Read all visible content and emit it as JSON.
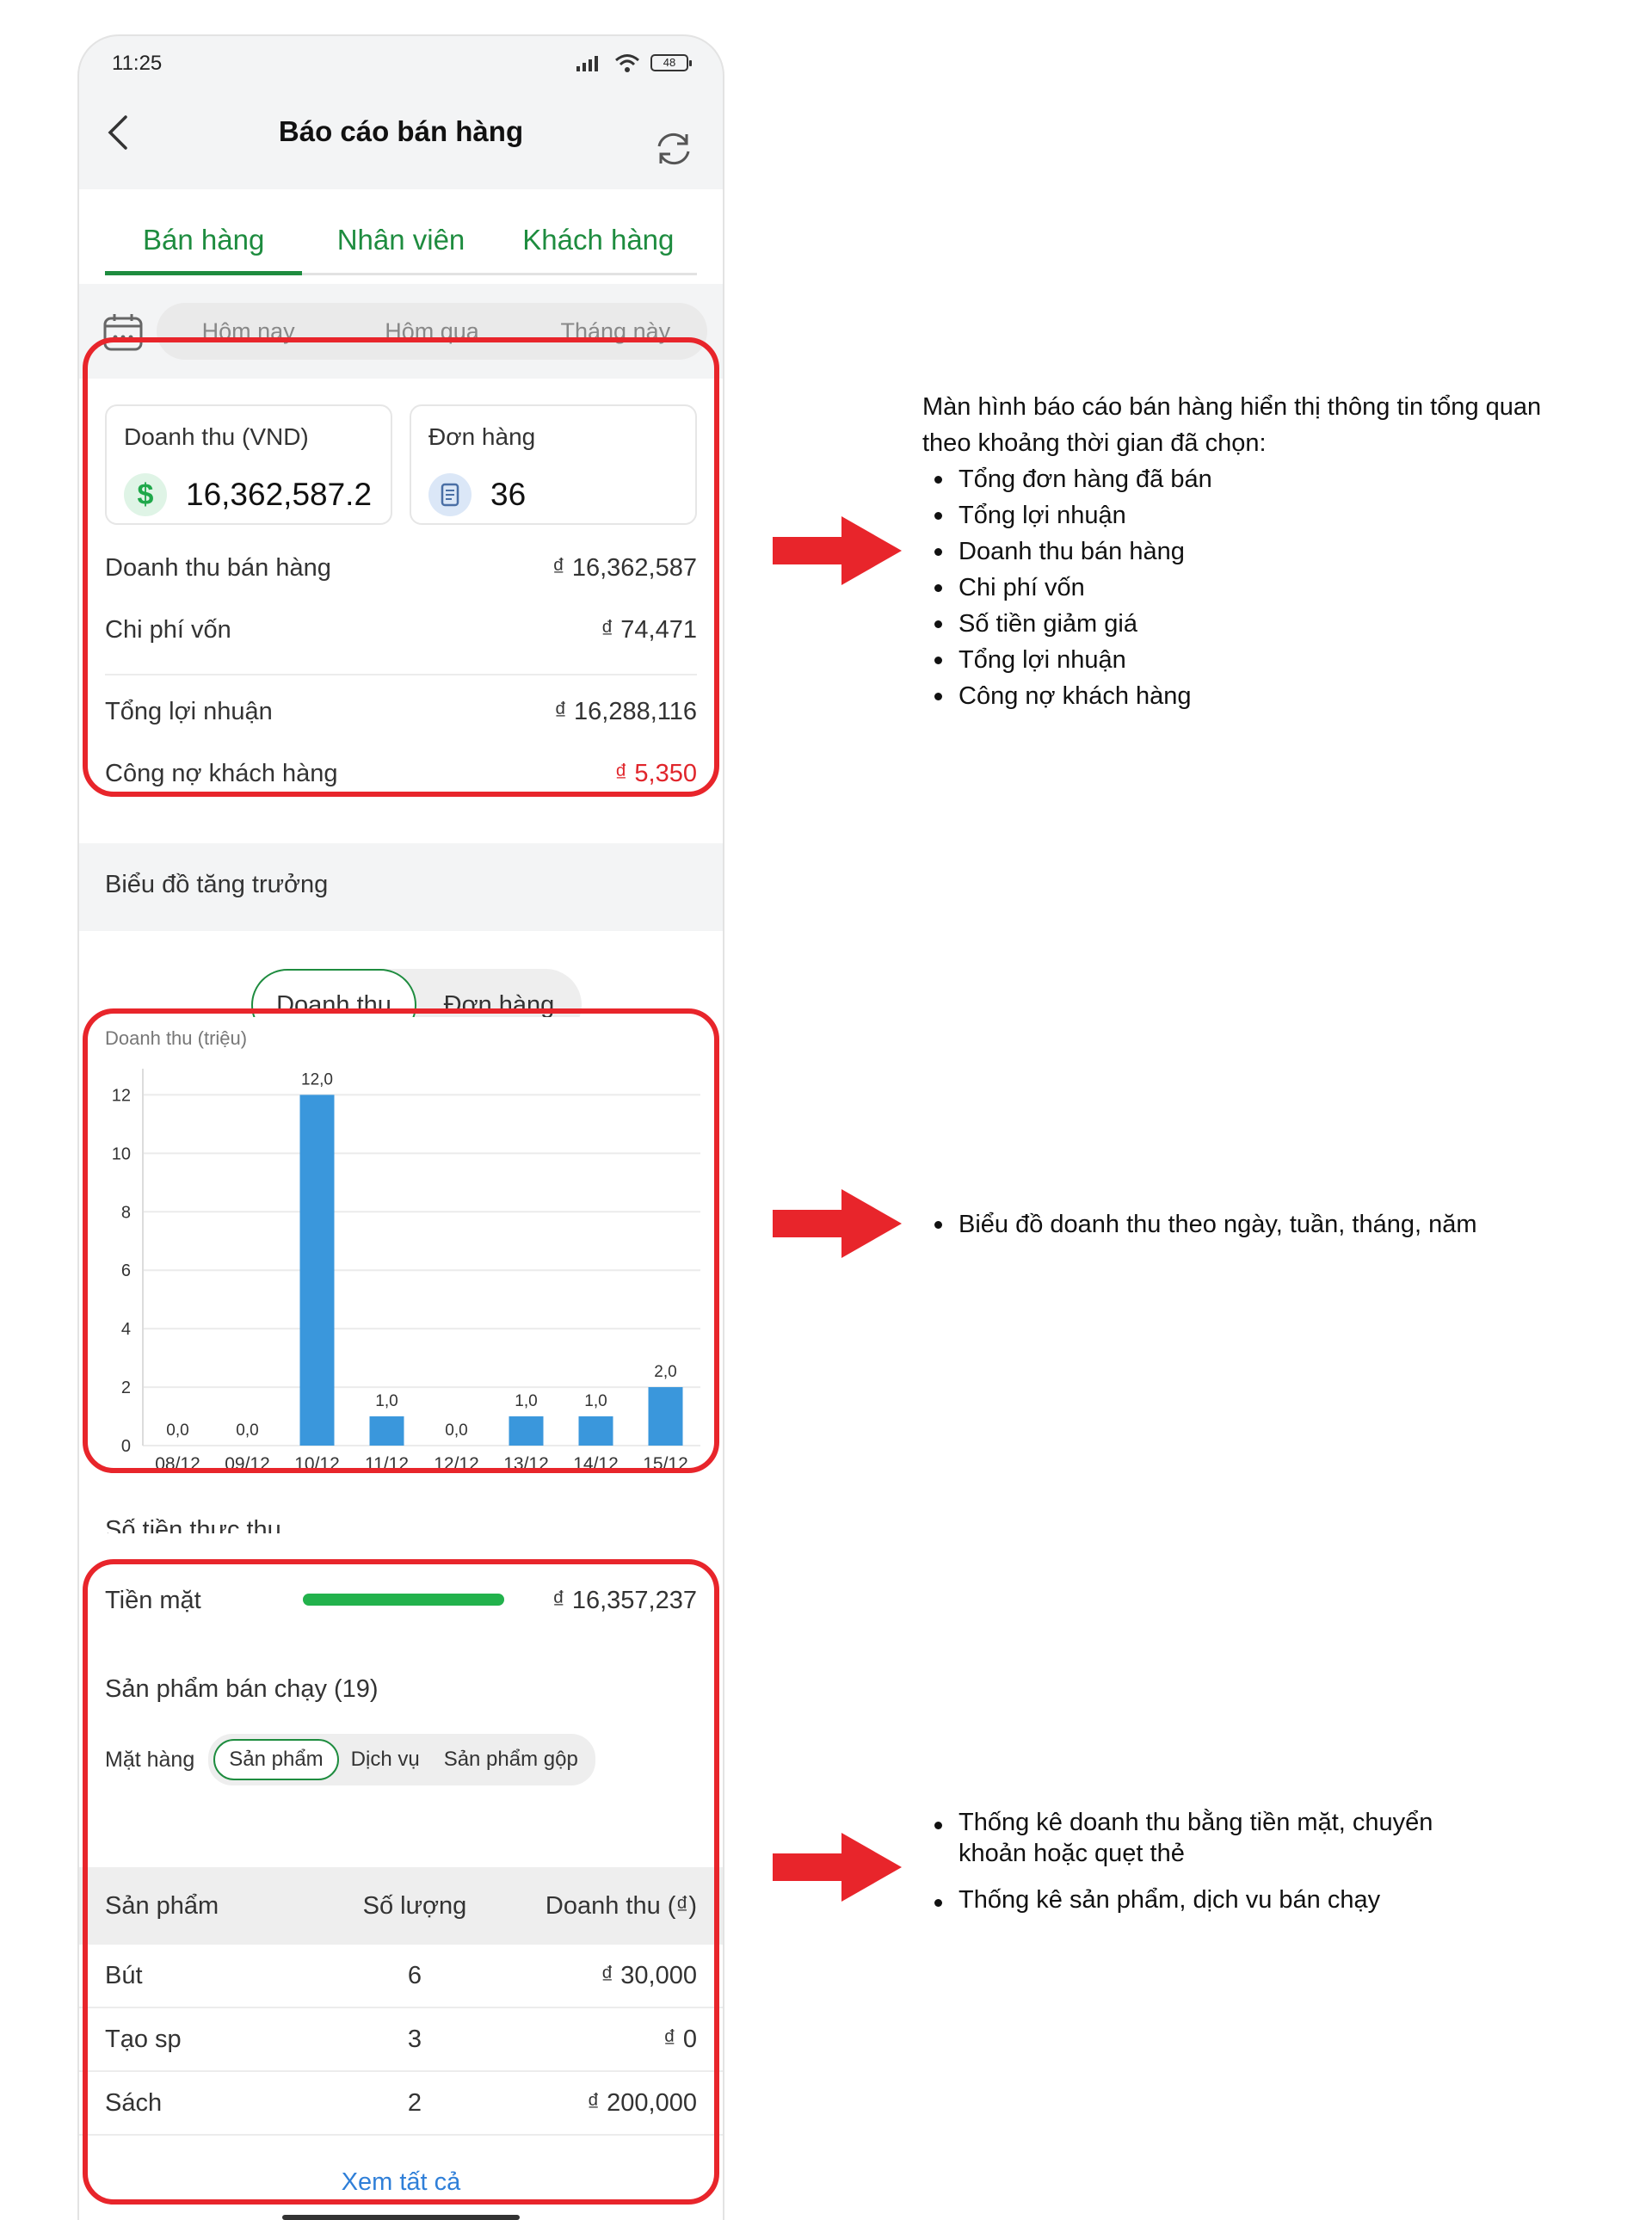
{
  "status_bar": {
    "time": "11:25",
    "battery": "48"
  },
  "header": {
    "title": "Báo cáo bán hàng"
  },
  "tabs": [
    {
      "label": "Bán hàng",
      "active": true
    },
    {
      "label": "Nhân viên",
      "active": false
    },
    {
      "label": "Khách hàng",
      "active": false
    }
  ],
  "date_filters": [
    "Hôm nay",
    "Hôm qua",
    "Tháng này"
  ],
  "summary": {
    "revenue_card": {
      "label": "Doanh thu (VND)",
      "value": "16,362,587.2"
    },
    "orders_card": {
      "label": "Đơn hàng",
      "value": "36"
    },
    "rows": [
      {
        "label": "Doanh thu bán hàng",
        "value": "₫ 16,362,587"
      },
      {
        "label": "Chi phí vốn",
        "value": "₫ 74,471"
      },
      {
        "label": "Tổng lợi nhuận",
        "value": "₫ 16,288,116"
      },
      {
        "label": "Công nợ khách hàng",
        "value": "₫ 5,350"
      }
    ]
  },
  "growth": {
    "title": "Biểu đồ tăng trưởng",
    "toggle": [
      {
        "label": "Doanh thu",
        "active": true
      },
      {
        "label": "Đơn hàng",
        "active": false
      }
    ]
  },
  "chart_data": {
    "type": "bar",
    "ylabel": "Doanh thu (triệu)",
    "categories": [
      "08/12",
      "09/12",
      "10/12",
      "11/12",
      "12/12",
      "13/12",
      "14/12",
      "15/12"
    ],
    "values": [
      0,
      0,
      12,
      1,
      0,
      1,
      1,
      2
    ],
    "data_labels": [
      "0,0",
      "0,0",
      "12,0",
      "1,0",
      "0,0",
      "1,0",
      "1,0",
      "2,0"
    ],
    "yticks": [
      0,
      2,
      4,
      6,
      8,
      10,
      12
    ],
    "ylim": [
      0,
      12.6
    ],
    "grid": true,
    "color": "#3a97dc"
  },
  "payment": {
    "title": "Số tiền thực thu",
    "method": "Tiền mặt",
    "amount": "₫ 16,357,237",
    "share": 1.0
  },
  "bestsellers": {
    "title": "Sản phẩm bán chạy (19)",
    "filter_label": "Mặt hàng",
    "filters": [
      {
        "label": "Sản phẩm",
        "active": true
      },
      {
        "label": "Dịch vụ",
        "active": false
      },
      {
        "label": "Sản phẩm gộp",
        "active": false
      }
    ],
    "columns": [
      "Sản phẩm",
      "Số lượng",
      "Doanh thu (₫)"
    ],
    "rows": [
      {
        "name": "Bút",
        "qty": "6",
        "revenue": "₫ 30,000"
      },
      {
        "name": "Tạo sp",
        "qty": "3",
        "revenue": "₫ 0"
      },
      {
        "name": "Sách",
        "qty": "2",
        "revenue": "₫ 200,000"
      }
    ],
    "view_all": "Xem tất cả"
  },
  "annotations": {
    "note1": {
      "intro": "Màn hình báo cáo bán hàng hiển thị thông tin tổng quan theo khoảng thời gian đã chọn:",
      "items": [
        "Tổng đơn hàng đã bán",
        "Tổng lợi nhuận",
        "Doanh thu bán hàng",
        "Chi phí vốn",
        "Số tiền giảm giá",
        "Tổng lợi nhuận",
        "Công nợ khách hàng"
      ]
    },
    "note2": {
      "items": [
        "Biểu đồ doanh thu theo ngày, tuần, tháng, năm"
      ]
    },
    "note3": {
      "items": [
        "Thống kê doanh thu bằng tiền mặt, chuyển khoản hoặc quẹt thẻ",
        "Thống kê sản phẩm, dịch vu bán chạy"
      ]
    },
    "accent": "#e8252b"
  }
}
